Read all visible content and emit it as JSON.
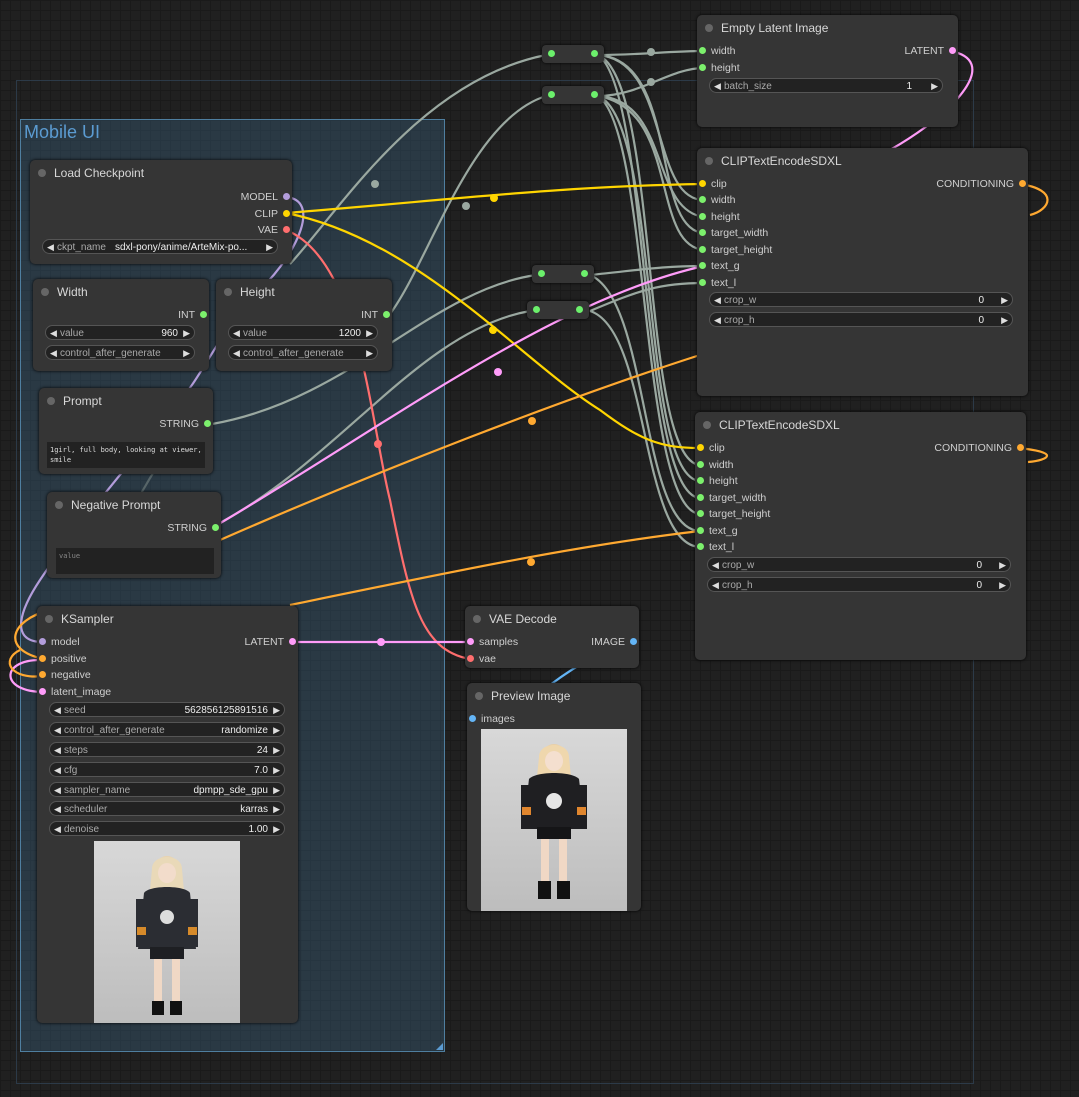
{
  "group": {
    "title": "Mobile UI"
  },
  "nodes": {
    "load_checkpoint": {
      "title": "Load Checkpoint",
      "outputs": [
        "MODEL",
        "CLIP",
        "VAE"
      ],
      "widget": {
        "label": "ckpt_name",
        "value": "sdxl-pony/anime/ArteMix-po..."
      }
    },
    "width": {
      "title": "Width",
      "output": "INT",
      "value_label": "value",
      "value": "960",
      "control_label": "control_after_generate"
    },
    "height": {
      "title": "Height",
      "output": "INT",
      "value_label": "value",
      "value": "1200",
      "control_label": "control_after_generate"
    },
    "prompt": {
      "title": "Prompt",
      "output": "STRING",
      "text": "1girl, full body, looking at viewer, smile"
    },
    "negative": {
      "title": "Negative Prompt",
      "output": "STRING",
      "placeholder": "value"
    },
    "ksampler": {
      "title": "KSampler",
      "inputs": [
        "model",
        "positive",
        "negative",
        "latent_image"
      ],
      "output": "LATENT",
      "widgets": [
        {
          "label": "seed",
          "value": "562856125891516"
        },
        {
          "label": "control_after_generate",
          "value": "randomize"
        },
        {
          "label": "steps",
          "value": "24"
        },
        {
          "label": "cfg",
          "value": "7.0"
        },
        {
          "label": "sampler_name",
          "value": "dpmpp_sde_gpu"
        },
        {
          "label": "scheduler",
          "value": "karras"
        },
        {
          "label": "denoise",
          "value": "1.00"
        }
      ]
    },
    "vae_decode": {
      "title": "VAE Decode",
      "inputs": [
        "samples",
        "vae"
      ],
      "output": "IMAGE"
    },
    "preview": {
      "title": "Preview Image",
      "input": "images"
    },
    "empty_latent": {
      "title": "Empty Latent Image",
      "inputs": [
        "width",
        "height"
      ],
      "output": "LATENT",
      "widget": {
        "label": "batch_size",
        "value": "1"
      }
    },
    "clip1": {
      "title": "CLIPTextEncodeSDXL",
      "inputs": [
        "clip",
        "width",
        "height",
        "target_width",
        "target_height",
        "text_g",
        "text_l"
      ],
      "output": "CONDITIONING",
      "widgets": [
        {
          "label": "crop_w",
          "value": "0"
        },
        {
          "label": "crop_h",
          "value": "0"
        }
      ]
    },
    "clip2": {
      "title": "CLIPTextEncodeSDXL",
      "inputs": [
        "clip",
        "width",
        "height",
        "target_width",
        "target_height",
        "text_g",
        "text_l"
      ],
      "output": "CONDITIONING",
      "widgets": [
        {
          "label": "crop_w",
          "value": "0"
        },
        {
          "label": "crop_h",
          "value": "0"
        }
      ]
    }
  },
  "colors": {
    "model": "#b39ddb",
    "clip": "#ffd500",
    "vae": "#ff6e6e",
    "latent": "#ff9cf9",
    "conditioning": "#ffa931",
    "int_string": "#9aa8a0",
    "image": "#64b5f6",
    "socket_green": "#7cf06c",
    "group": "#3e6a8a"
  },
  "icons": {
    "decrement": "arrow-left-icon",
    "increment": "arrow-right-icon"
  }
}
